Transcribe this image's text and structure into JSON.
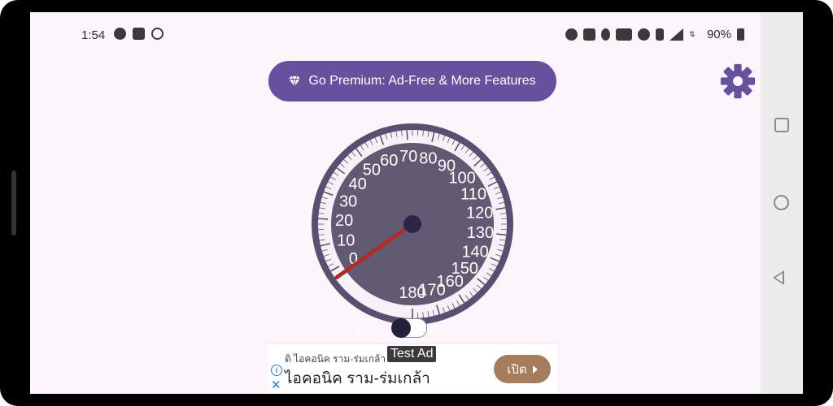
{
  "status_bar": {
    "time": "1:54",
    "battery_percent": "90%",
    "left_icons": [
      "brightness-icon",
      "sim-icon",
      "speed-icon"
    ],
    "right_icons": [
      "alarm-icon",
      "nfc-icon",
      "location-icon",
      "volte-icon",
      "dnd-icon",
      "vibrate-icon",
      "signal-icon",
      "5g-icon"
    ]
  },
  "premium": {
    "label": "Go Premium: Ad-Free & More Features",
    "icon": "diamond-icon"
  },
  "settings": {
    "icon": "gear-icon"
  },
  "speedometer": {
    "tick_labels": [
      "0",
      "10",
      "20",
      "30",
      "40",
      "50",
      "60",
      "70",
      "80",
      "90",
      "100",
      "110",
      "120",
      "130",
      "140",
      "150",
      "160",
      "170",
      "180"
    ],
    "min": 0,
    "max": 180,
    "needle_value": 0,
    "colors": {
      "face": "#625a72",
      "rim": "#5a4f6e",
      "needle": "#b32a2a",
      "hub": "#2b2645"
    }
  },
  "unit_toggle": {
    "label": "Km/h",
    "state": "off"
  },
  "ad": {
    "tag": "Test Ad",
    "small_text": "ดิ ไอคอนิค ราม-ร่มเกล้า",
    "headline": "ไอคอนิค ราม-ร่มเกล้า",
    "cta_label": "เปิด"
  },
  "navigation": {
    "buttons": [
      "recents-icon",
      "home-icon",
      "back-icon"
    ]
  }
}
